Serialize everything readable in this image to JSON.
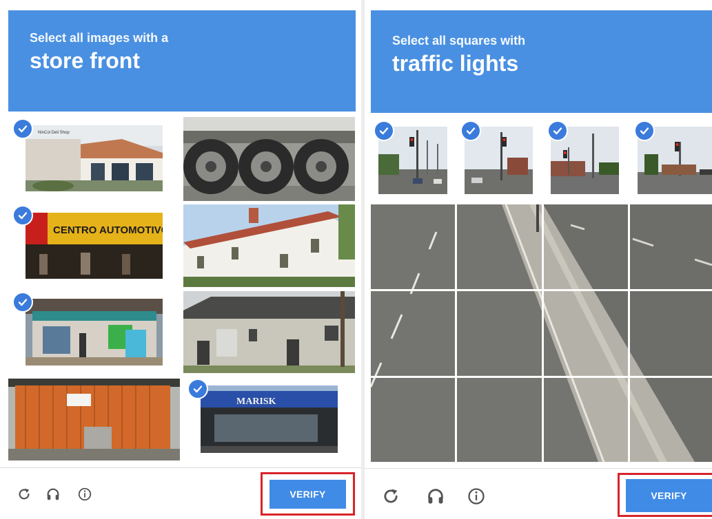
{
  "left": {
    "instruction_line1": "Select all images with a",
    "instruction_line2": "store front",
    "tiles": [
      {
        "caption": "NinCol Deli Shop",
        "selected": true
      },
      {
        "caption": "",
        "selected": false
      },
      {
        "caption": "CENTRO AUTOMOTIVO",
        "selected": true
      },
      {
        "caption": "",
        "selected": false
      },
      {
        "caption": "",
        "selected": true
      },
      {
        "caption": "",
        "selected": false
      },
      {
        "caption": "",
        "selected": false
      },
      {
        "caption": "MARISK",
        "selected": true
      }
    ],
    "verify_label": "VERIFY"
  },
  "right": {
    "instruction_line1": "Select all squares with",
    "instruction_line2": "traffic lights",
    "top_tiles_selected": [
      true,
      true,
      true,
      true
    ],
    "verify_label": "VERIFY"
  },
  "icons": {
    "reload": "reload-icon",
    "audio": "headphones-icon",
    "info": "info-icon"
  },
  "colors": {
    "header": "#4a90e2",
    "check": "#3a7bdc",
    "verify": "#3f8be6",
    "highlight": "#d8232a"
  }
}
